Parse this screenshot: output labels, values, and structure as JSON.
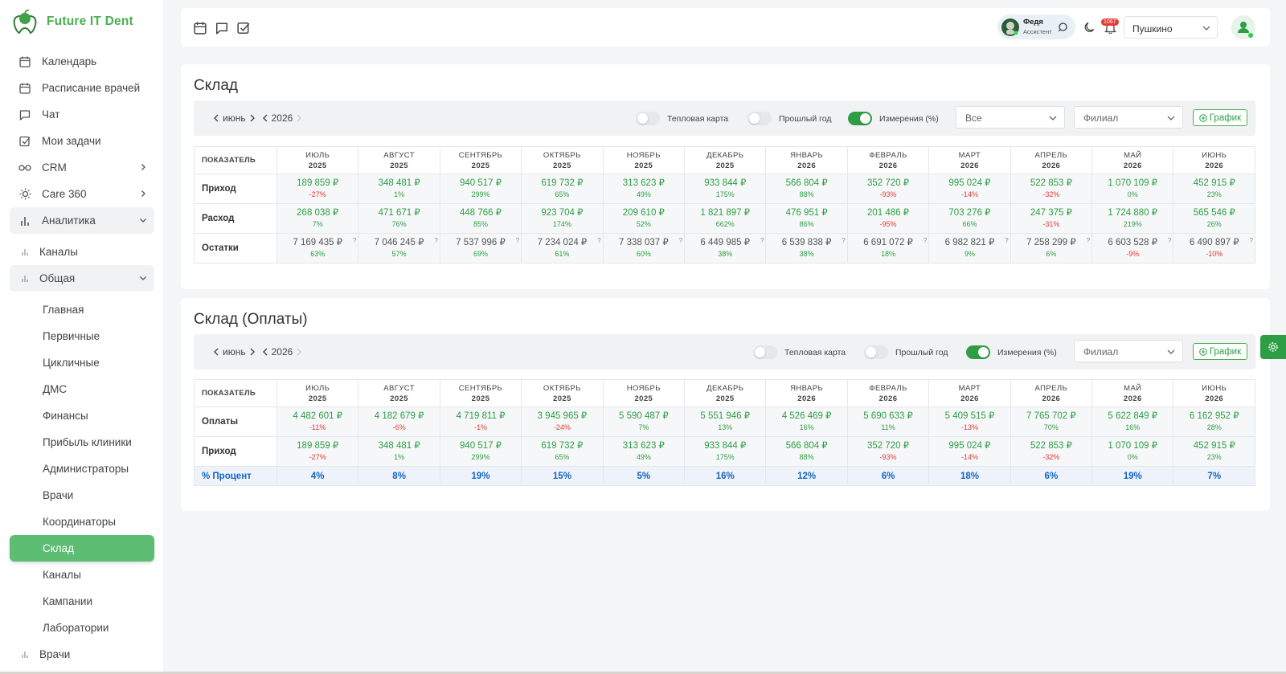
{
  "app": {
    "name": "Future IT Dent"
  },
  "sidebar": {
    "items": [
      {
        "label": "Календарь"
      },
      {
        "label": "Расписание врачей"
      },
      {
        "label": "Чат"
      },
      {
        "label": "Мои задачи"
      },
      {
        "label": "CRM"
      },
      {
        "label": "Care 360"
      },
      {
        "label": "Аналитика"
      },
      {
        "label": "Каналы"
      },
      {
        "label": "Общая"
      },
      {
        "label": "Главная"
      },
      {
        "label": "Первичные"
      },
      {
        "label": "Цикличные"
      },
      {
        "label": "ДМС"
      },
      {
        "label": "Финансы"
      },
      {
        "label": "Прибыль клиники"
      },
      {
        "label": "Администраторы"
      },
      {
        "label": "Врачи"
      },
      {
        "label": "Координаторы"
      },
      {
        "label": "Склад"
      },
      {
        "label": "Каналы"
      },
      {
        "label": "Кампании"
      },
      {
        "label": "Лаборатории"
      },
      {
        "label": "Врачи"
      }
    ]
  },
  "topbar": {
    "assistant_name": "Федя",
    "assistant_role": "Ассистент",
    "notifications": "1067",
    "city": "Пушкино"
  },
  "sklad": {
    "title": "Склад",
    "month": "июнь",
    "year": "2026",
    "toggle_heat": "Тепловая карта",
    "toggle_prev": "Прошлый год",
    "toggle_meas": "Измерения (%)",
    "filter_all": "Все",
    "filter_branch": "Филиал",
    "graph_btn": "График",
    "header_label": "ПОКАЗАТЕЛЬ",
    "columns": [
      {
        "m": "ИЮЛЬ",
        "y": "2025"
      },
      {
        "m": "АВГУСТ",
        "y": "2025"
      },
      {
        "m": "СЕНТЯБРЬ",
        "y": "2025"
      },
      {
        "m": "ОКТЯБРЬ",
        "y": "2025"
      },
      {
        "m": "НОЯБРЬ",
        "y": "2025"
      },
      {
        "m": "ДЕКАБРЬ",
        "y": "2025"
      },
      {
        "m": "ЯНВАРЬ",
        "y": "2026"
      },
      {
        "m": "ФЕВРАЛЬ",
        "y": "2026"
      },
      {
        "m": "МАРТ",
        "y": "2026"
      },
      {
        "m": "АПРЕЛЬ",
        "y": "2026"
      },
      {
        "m": "МАЙ",
        "y": "2026"
      },
      {
        "m": "ИЮНЬ",
        "y": "2026"
      }
    ],
    "rows": [
      {
        "label": "Приход",
        "style": "g",
        "cells": [
          [
            "189 859 ₽",
            "-27%"
          ],
          [
            "348 481 ₽",
            "1%"
          ],
          [
            "940 517 ₽",
            "299%"
          ],
          [
            "619 732 ₽",
            "65%"
          ],
          [
            "313 623 ₽",
            "49%"
          ],
          [
            "933 844 ₽",
            "175%"
          ],
          [
            "566 804 ₽",
            "88%"
          ],
          [
            "352 720 ₽",
            "-93%"
          ],
          [
            "995 024 ₽",
            "-14%"
          ],
          [
            "522 853 ₽",
            "-32%"
          ],
          [
            "1 070 109 ₽",
            "0%"
          ],
          [
            "452 915 ₽",
            "23%"
          ]
        ]
      },
      {
        "label": "Расход",
        "style": "g",
        "cells": [
          [
            "268 038 ₽",
            "7%"
          ],
          [
            "471 671 ₽",
            "76%"
          ],
          [
            "448 766 ₽",
            "85%"
          ],
          [
            "923 704 ₽",
            "174%"
          ],
          [
            "209 610 ₽",
            "52%"
          ],
          [
            "1 821 897 ₽",
            "662%"
          ],
          [
            "476 951 ₽",
            "86%"
          ],
          [
            "201 486 ₽",
            "-95%"
          ],
          [
            "703 276 ₽",
            "66%"
          ],
          [
            "247 375 ₽",
            "-31%"
          ],
          [
            "1 724 880 ₽",
            "219%"
          ],
          [
            "565 546 ₽",
            "26%"
          ]
        ]
      },
      {
        "label": "Остатки",
        "style": "n",
        "cells": [
          [
            "7 169 435 ₽",
            "63%"
          ],
          [
            "7 046 245 ₽",
            "57%"
          ],
          [
            "7 537 996 ₽",
            "69%"
          ],
          [
            "7 234 024 ₽",
            "61%"
          ],
          [
            "7 338 037 ₽",
            "60%"
          ],
          [
            "6 449 985 ₽",
            "38%"
          ],
          [
            "6 539 838 ₽",
            "38%"
          ],
          [
            "6 691 072 ₽",
            "18%"
          ],
          [
            "6 982 821 ₽",
            "9%"
          ],
          [
            "7 258 299 ₽",
            "6%"
          ],
          [
            "6 603 528 ₽",
            "-9%"
          ],
          [
            "6 490 897 ₽",
            "-10%"
          ]
        ]
      }
    ]
  },
  "sklad_pay": {
    "title": "Склад (Оплаты)",
    "month": "июнь",
    "year": "2026",
    "toggle_heat": "Тепловая карта",
    "toggle_prev": "Прошлый год",
    "toggle_meas": "Измерения (%)",
    "filter_branch": "Филиал",
    "graph_btn": "График",
    "header_label": "ПОКАЗАТЕЛЬ",
    "rows": [
      {
        "label": "Оплаты",
        "style": "g",
        "cells": [
          [
            "4 482 601 ₽",
            "-11%"
          ],
          [
            "4 182 679 ₽",
            "-6%"
          ],
          [
            "4 719 811 ₽",
            "-1%"
          ],
          [
            "3 945 965 ₽",
            "-24%"
          ],
          [
            "5 590 487 ₽",
            "7%"
          ],
          [
            "5 551 946 ₽",
            "13%"
          ],
          [
            "4 526 469 ₽",
            "16%"
          ],
          [
            "5 690 633 ₽",
            "11%"
          ],
          [
            "5 409 515 ₽",
            "-13%"
          ],
          [
            "7 765 702 ₽",
            "70%"
          ],
          [
            "5 622 849 ₽",
            "16%"
          ],
          [
            "6 162 952 ₽",
            "28%"
          ]
        ]
      },
      {
        "label": "Приход",
        "style": "g",
        "cells": [
          [
            "189 859 ₽",
            "-27%"
          ],
          [
            "348 481 ₽",
            "1%"
          ],
          [
            "940 517 ₽",
            "299%"
          ],
          [
            "619 732 ₽",
            "65%"
          ],
          [
            "313 623 ₽",
            "49%"
          ],
          [
            "933 844 ₽",
            "175%"
          ],
          [
            "566 804 ₽",
            "88%"
          ],
          [
            "352 720 ₽",
            "-93%"
          ],
          [
            "995 024 ₽",
            "-14%"
          ],
          [
            "522 853 ₽",
            "-32%"
          ],
          [
            "1 070 109 ₽",
            "0%"
          ],
          [
            "452 915 ₽",
            "23%"
          ]
        ]
      }
    ],
    "percent_label": "% Процент",
    "percent": [
      "4%",
      "8%",
      "19%",
      "15%",
      "5%",
      "16%",
      "12%",
      "6%",
      "18%",
      "6%",
      "19%",
      "7%"
    ]
  },
  "colors": {
    "accent": "#2e9e45",
    "active_nav": "#5dbd73",
    "negative": "#e53935",
    "percent": "#1565c0"
  }
}
